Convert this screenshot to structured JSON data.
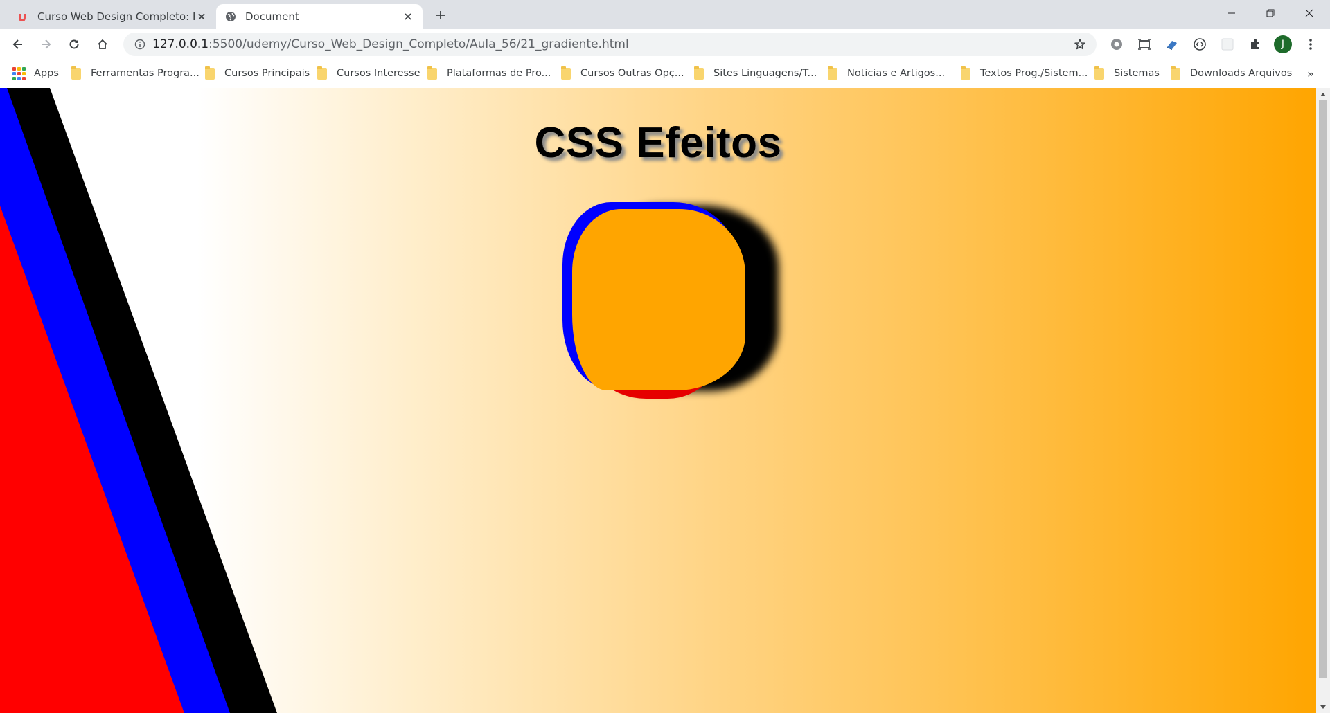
{
  "browser": {
    "tabs": [
      {
        "title": "Curso Web Design Completo: HT",
        "icon": "udemy-icon",
        "active": false
      },
      {
        "title": "Document",
        "icon": "globe-icon",
        "active": true
      }
    ],
    "url": {
      "host": "127.0.0.1",
      "path": ":5500/udemy/Curso_Web_Design_Completo/Aula_56/21_gradiente.html"
    },
    "avatar_initial": "J",
    "bookmarks": {
      "apps_label": "Apps",
      "items": [
        "Ferramentas Progra...",
        "Cursos Principais",
        "Cursos Interesse",
        "Plataformas de Pro...",
        "Cursos Outras Opç...",
        "Sites Linguagens/T...",
        "Noticias e Artigos...",
        "Textos Prog./Sistem...",
        "Sistemas",
        "Downloads Arquivos"
      ],
      "more": "»"
    }
  },
  "page": {
    "heading": "CSS Efeitos",
    "colors": {
      "gradient_start": "#ffffff",
      "gradient_end": "#ffa500",
      "stripe_red": "#ff0000",
      "stripe_blue": "#0000ff",
      "stripe_black": "#000000",
      "box_fill": "#ffa500"
    }
  }
}
